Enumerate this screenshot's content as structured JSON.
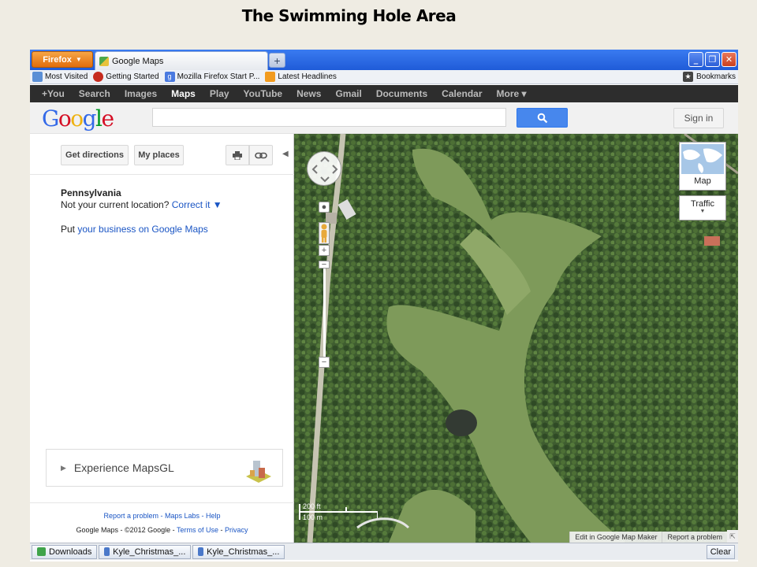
{
  "slide": {
    "title": "The Swimming Hole Area"
  },
  "browser": {
    "menu_label": "Firefox",
    "tab_title": "Google Maps",
    "bookmarks": [
      {
        "label": "Most Visited",
        "icon": "most-visited-icon",
        "color": "#5b8fd6"
      },
      {
        "label": "Getting Started",
        "icon": "firefox-icon",
        "color": "#c62b1e"
      },
      {
        "label": "Mozilla Firefox Start P...",
        "icon": "google-g-icon",
        "color": "#4a7ae0"
      },
      {
        "label": "Latest Headlines",
        "icon": "rss-feed-icon",
        "color": "#f29b1f"
      }
    ],
    "bookmarks_menu": "Bookmarks"
  },
  "google_bar": {
    "items": [
      "+You",
      "Search",
      "Images",
      "Maps",
      "Play",
      "YouTube",
      "News",
      "Gmail",
      "Documents",
      "Calendar",
      "More ▾"
    ],
    "active": "Maps"
  },
  "header": {
    "logo": [
      "G",
      "o",
      "o",
      "g",
      "l",
      "e"
    ],
    "logo_colors": [
      "#3369e8",
      "#d50f25",
      "#eeb211",
      "#3369e8",
      "#009925",
      "#d50f25"
    ],
    "search_value": "",
    "sign_in": "Sign in",
    "accent": "#4787ed"
  },
  "panel": {
    "get_directions": "Get directions",
    "my_places": "My places",
    "location_title": "Pennsylvania",
    "location_question": "Not your current location?",
    "correct_it": "Correct it ▼",
    "put_prefix": "Put",
    "put_link": "your business on Google Maps",
    "mapsgl": "Experience MapsGL",
    "footer_links": "Report a problem - Maps Labs - Help",
    "footer_copyright": "Google Maps - ©2012 Google -",
    "footer_terms": "Terms of Use",
    "footer_sep": "-",
    "footer_privacy": "Privacy"
  },
  "map": {
    "map_type": "Map",
    "traffic": "Traffic",
    "scale_ft": "200 ft",
    "scale_m": "100 m",
    "edit_link": "Edit in Google Map Maker",
    "report_link": "Report a problem"
  },
  "statusbar": {
    "downloads": "Downloads",
    "task1": "Kyle_Christmas_...",
    "task2": "Kyle_Christmas_...",
    "clear": "Clear"
  }
}
